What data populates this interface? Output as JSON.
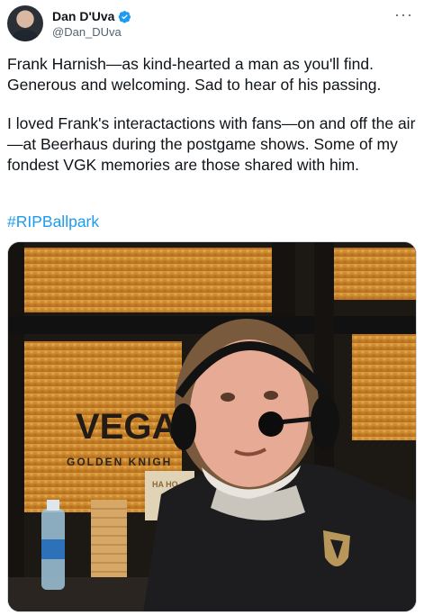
{
  "tweet": {
    "author_name": "Dan D'Uva",
    "author_handle": "@Dan_DUva",
    "paragraph_1": "Frank Harnish—as kind-hearted a man as you'll find. Generous and welcoming. Sad to hear of his passing.",
    "paragraph_2": "I loved Frank's interactactions with fans—on and off the air—at Beerhaus during the postgame shows. Some of my fondest VGK memories are those shared with him.",
    "hashtag": "#RIPBallpark",
    "more_label": "···"
  },
  "photo": {
    "sign_text_1": "VEGAS",
    "sign_text_2": "GOLDEN KNIGH",
    "box_text": "HA HO"
  },
  "colors": {
    "link": "#1d9bf0",
    "verified": "#1d9bf0",
    "secondary_text": "#536471"
  },
  "icons": {
    "verified": "verified-badge-icon",
    "more": "more-options-icon"
  }
}
